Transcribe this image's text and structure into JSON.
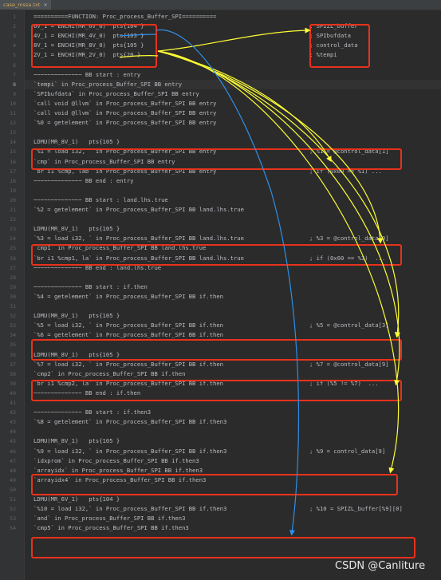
{
  "tab": {
    "file_name": "case_mssa.txt",
    "close": "×"
  },
  "lines": [
    {
      "num": "1",
      "text": "==========FUNCTION: Proc_process_Buffer_SPI==========",
      "comment": ""
    },
    {
      "num": "2",
      "text": "6V_1 = ENCHI(MR_6V_0)  pts{104 }",
      "comment": "; SPIZL_buffer"
    },
    {
      "num": "3",
      "text": "4V_1 = ENCHI(MR_4V_0)  pts{103 }",
      "comment": "; SPIbufdata"
    },
    {
      "num": "4",
      "text": "8V_1 = ENCHI(MR_8V_0)  pts{105 }",
      "comment": "; control_data"
    },
    {
      "num": "5",
      "text": "2V_1 = ENCHI(MR_2V_0)  pts{20 }",
      "comment": "; %tempi"
    },
    {
      "num": "6",
      "text": "",
      "comment": ""
    },
    {
      "num": "7",
      "text": "~~~~~~~~~~~~~~ BB start : entry",
      "comment": ""
    },
    {
      "num": "8",
      "text": "`tempi` in Proc_process_Buffer_SPI BB entry",
      "comment": ""
    },
    {
      "num": "9",
      "text": "`SPIbufdata` in Proc_process_Buffer_SPI BB entry",
      "comment": ""
    },
    {
      "num": "10",
      "text": "`call void @llvm` in Proc_process_Buffer_SPI BB entry",
      "comment": ""
    },
    {
      "num": "11",
      "text": "`call void @llvm` in Proc_process_Buffer_SPI BB entry",
      "comment": ""
    },
    {
      "num": "12",
      "text": "`%0 = getelement` in Proc_process_Buffer_SPI BB entry",
      "comment": ""
    },
    {
      "num": "13",
      "text": "",
      "comment": ""
    },
    {
      "num": "14",
      "text": "LDMU(MR_8V_1)   pts{105 }",
      "comment": ""
    },
    {
      "num": "15",
      "text": "`%1 = load i32, ` in Proc_process_Buffer_SPI BB entry",
      "comment": "; %1 = @control_data[1]"
    },
    {
      "num": "16",
      "text": "`cmp` in Proc_process_Buffer_SPI BB entry",
      "comment": ""
    },
    {
      "num": "17",
      "text": "`br i1 %cmp, lab` in Proc_process_Buffer_SPI BB entry",
      "comment": "; if (0x00 == %1) ..."
    },
    {
      "num": "18",
      "text": "~~~~~~~~~~~~~~ BB end : entry",
      "comment": ""
    },
    {
      "num": "19",
      "text": "",
      "comment": ""
    },
    {
      "num": "20",
      "text": "~~~~~~~~~~~~~~ BB start : land.lhs.true",
      "comment": ""
    },
    {
      "num": "21",
      "text": "`%2 = getelement` in Proc_process_Buffer_SPI BB land.lhs.true",
      "comment": ""
    },
    {
      "num": "22",
      "text": "",
      "comment": ""
    },
    {
      "num": "23",
      "text": "LDMU(MR_8V_1)   pts{105 }",
      "comment": ""
    },
    {
      "num": "24",
      "text": "`%3 = load i32, ` in Proc_process_Buffer_SPI BB land.lhs.true",
      "comment": "; %3 = @control_data[0]"
    },
    {
      "num": "25",
      "text": "`cmp1` in Proc_process_Buffer_SPI BB land.lhs.true",
      "comment": ""
    },
    {
      "num": "26",
      "text": "`br i1 %cmp1, la` in Proc_process_Buffer_SPI BB land.lhs.true",
      "comment": "; if (0x00 == %3)  ..."
    },
    {
      "num": "27",
      "text": "~~~~~~~~~~~~~~ BB end : land.lhs.true",
      "comment": ""
    },
    {
      "num": "28",
      "text": "",
      "comment": ""
    },
    {
      "num": "29",
      "text": "~~~~~~~~~~~~~~ BB start : if.then",
      "comment": ""
    },
    {
      "num": "30",
      "text": "`%4 = getelement` in Proc_process_Buffer_SPI BB if.then",
      "comment": ""
    },
    {
      "num": "31",
      "text": "",
      "comment": ""
    },
    {
      "num": "32",
      "text": "LDMU(MR_8V_1)   pts{105 }",
      "comment": ""
    },
    {
      "num": "33",
      "text": "`%5 = load i32, ` in Proc_process_Buffer_SPI BB if.then",
      "comment": "; %5 = @control_data[3]"
    },
    {
      "num": "34",
      "text": "`%6 = getelement` in Proc_process_Buffer_SPI BB if.then",
      "comment": ""
    },
    {
      "num": "35",
      "text": "",
      "comment": ""
    },
    {
      "num": "36",
      "text": "LDMU(MR_8V_1)   pts{105 }",
      "comment": ""
    },
    {
      "num": "37",
      "text": "`%7 = load i32, ` in Proc_process_Buffer_SPI BB if.then",
      "comment": "; %7 = @control_data[9]"
    },
    {
      "num": "38",
      "text": "`cmp2` in Proc_process_Buffer_SPI BB if.then",
      "comment": ""
    },
    {
      "num": "39",
      "text": "`br i1 %cmp2, la` in Proc_process_Buffer_SPI BB if.then",
      "comment": "; if (%5 != %7)  ..."
    },
    {
      "num": "40",
      "text": "~~~~~~~~~~~~~~ BB end : if.then",
      "comment": ""
    },
    {
      "num": "41",
      "text": "",
      "comment": ""
    },
    {
      "num": "42",
      "text": "~~~~~~~~~~~~~~ BB start : if.then3",
      "comment": ""
    },
    {
      "num": "43",
      "text": "`%8 = getelement` in Proc_process_Buffer_SPI BB if.then3",
      "comment": ""
    },
    {
      "num": "44",
      "text": "",
      "comment": ""
    },
    {
      "num": "45",
      "text": "LDMU(MR_8V_1)   pts{105 }",
      "comment": ""
    },
    {
      "num": "46",
      "text": "`%9 = load i32, ` in Proc_process_Buffer_SPI BB if.then3",
      "comment": "; %9 = control_data[9]"
    },
    {
      "num": "47",
      "text": "`idxprom` in Proc_process_Buffer_SPI BB if.then3",
      "comment": ""
    },
    {
      "num": "48",
      "text": "`arrayidx` in Proc_process_Buffer_SPI BB if.then3",
      "comment": ""
    },
    {
      "num": "49",
      "text": "`arrayidx4` in Proc_process_Buffer_SPI BB if.then3",
      "comment": ""
    },
    {
      "num": "50",
      "text": "",
      "comment": ""
    },
    {
      "num": "51",
      "text": "LDMU(MR_6V_1)   pts{104 }",
      "comment": ""
    },
    {
      "num": "52",
      "text": "`%10 = load i32,` in Proc_process_Buffer_SPI BB if.then3",
      "comment": "; %10 = SPIZL_buffer[%9][0]"
    },
    {
      "num": "53",
      "text": "`and` in Proc_process_Buffer_SPI BB if.then3",
      "comment": ""
    },
    {
      "num": "54",
      "text": "`cmp5` in Proc_process_Buffer_SPI BB if.then3",
      "comment": ""
    }
  ],
  "watermark": "CSDN @Canliture",
  "colors": {
    "highlight_box": "#e8321c",
    "arrow_yellow": "#ffff33",
    "arrow_blue": "#2f8fe6",
    "background": "#2b2b2b"
  }
}
